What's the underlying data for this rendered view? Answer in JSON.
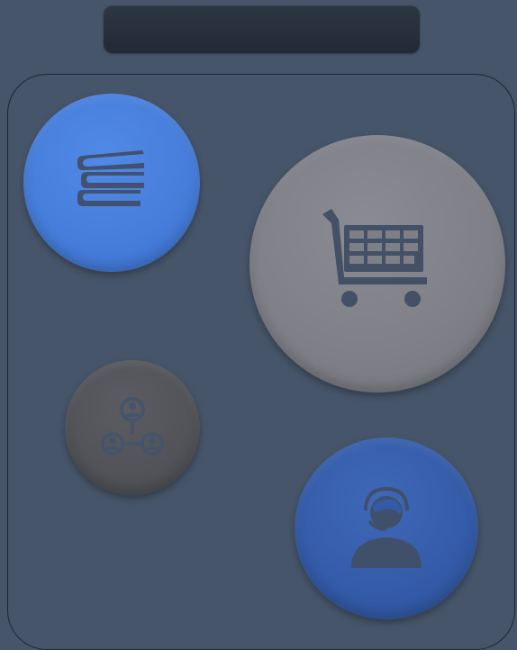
{
  "header": {
    "title": ""
  },
  "buttons": [
    {
      "id": "library",
      "label": "",
      "icon": "books-icon",
      "color": "#467dda",
      "icon_color": "#415170"
    },
    {
      "id": "cart",
      "label": "",
      "icon": "shopping-cart-icon",
      "color": "#7f8087",
      "icon_color": "#435066"
    },
    {
      "id": "network",
      "label": "",
      "icon": "user-network-icon",
      "color": "#525358",
      "icon_color": "#46546a"
    },
    {
      "id": "support",
      "label": "",
      "icon": "support-agent-icon",
      "color": "#345ba8",
      "icon_color": "#40506a"
    }
  ],
  "colors": {
    "background": "#465569",
    "top_bar": "#262e3a",
    "panel_border": "#1f2632"
  }
}
